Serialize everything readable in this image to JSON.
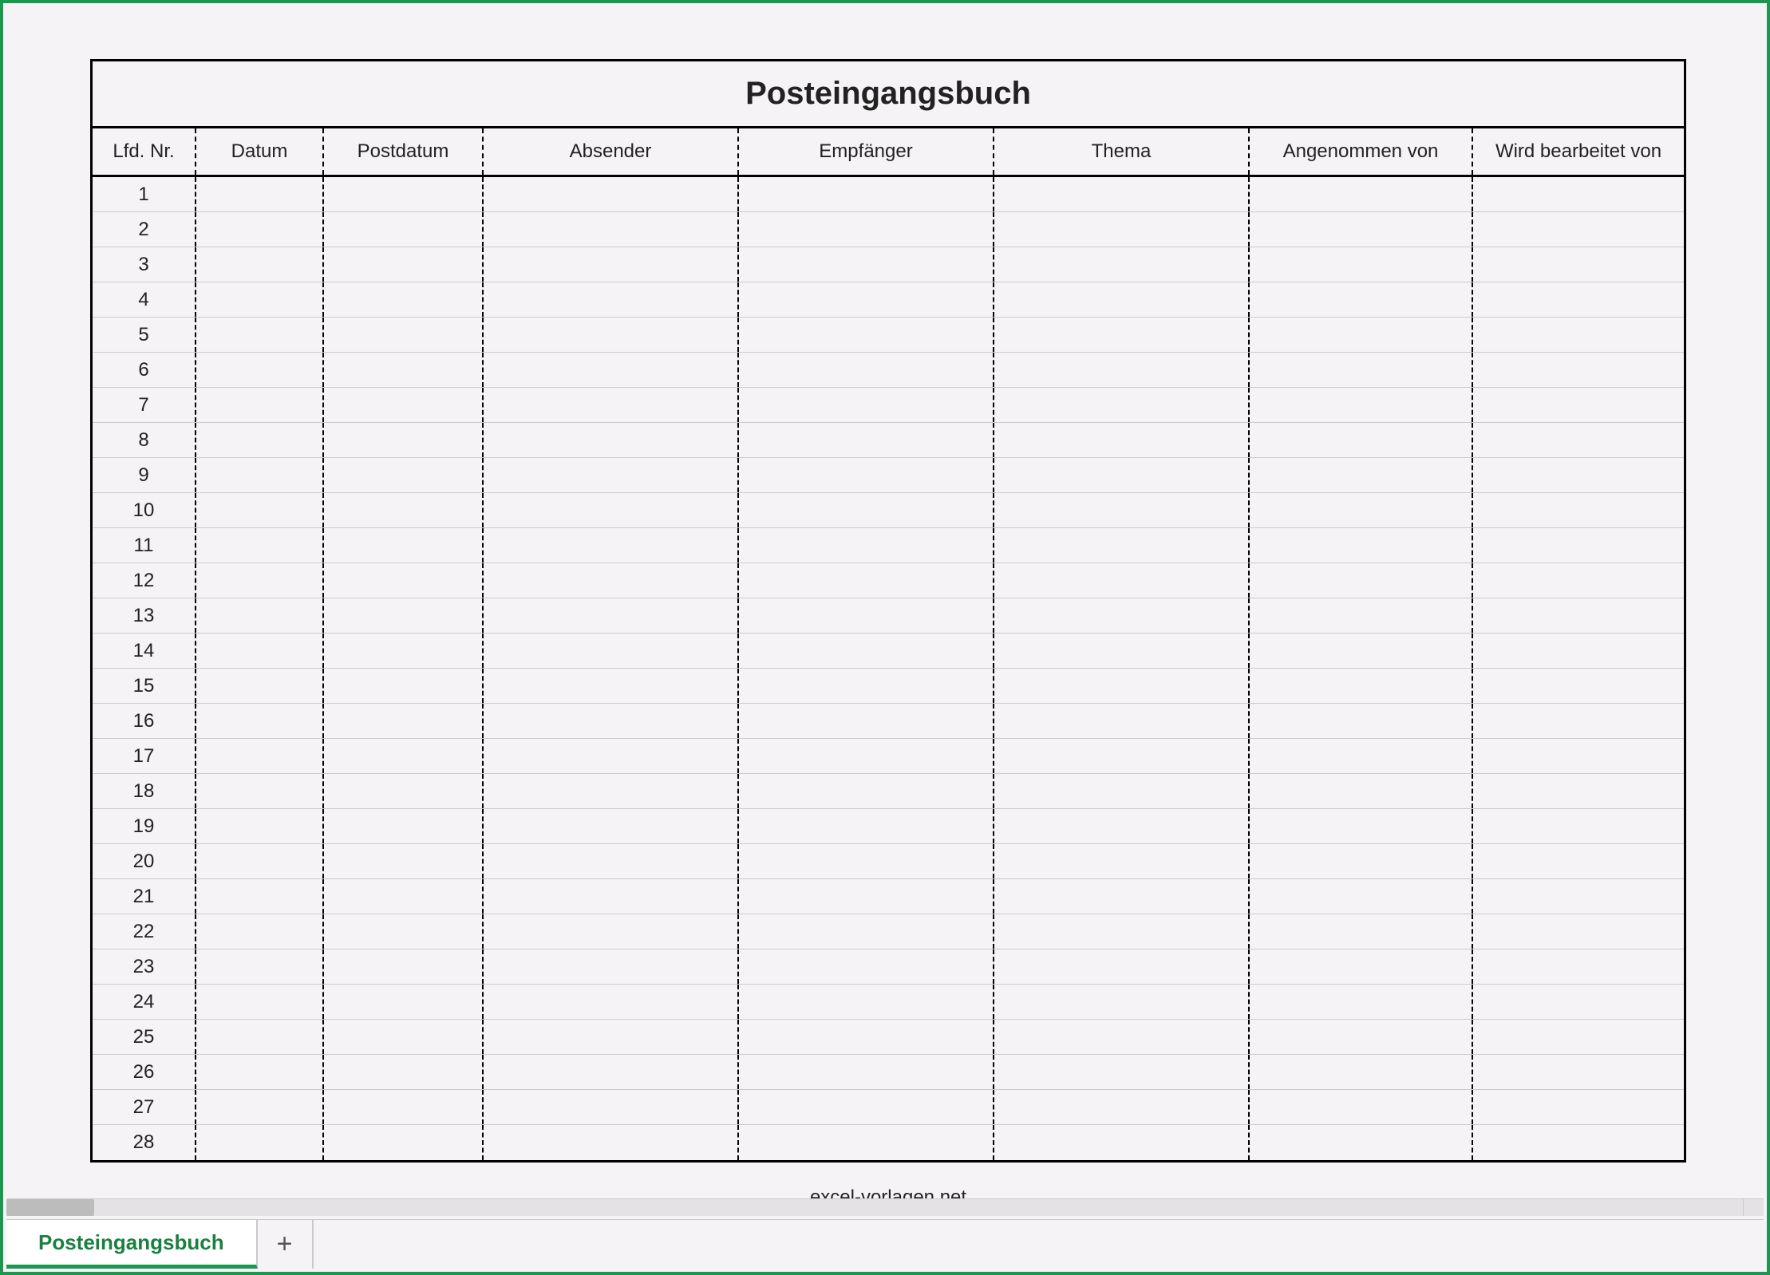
{
  "title": "Posteingangsbuch",
  "columns": [
    "Lfd. Nr.",
    "Datum",
    "Postdatum",
    "Absender",
    "Empfänger",
    "Thema",
    "Angenommen von",
    "Wird bearbeitet von"
  ],
  "rows": [
    {
      "nr": "1"
    },
    {
      "nr": "2"
    },
    {
      "nr": "3"
    },
    {
      "nr": "4"
    },
    {
      "nr": "5"
    },
    {
      "nr": "6"
    },
    {
      "nr": "7"
    },
    {
      "nr": "8"
    },
    {
      "nr": "9"
    },
    {
      "nr": "10"
    },
    {
      "nr": "11"
    },
    {
      "nr": "12"
    },
    {
      "nr": "13"
    },
    {
      "nr": "14"
    },
    {
      "nr": "15"
    },
    {
      "nr": "16"
    },
    {
      "nr": "17"
    },
    {
      "nr": "18"
    },
    {
      "nr": "19"
    },
    {
      "nr": "20"
    },
    {
      "nr": "21"
    },
    {
      "nr": "22"
    },
    {
      "nr": "23"
    },
    {
      "nr": "24"
    },
    {
      "nr": "25"
    },
    {
      "nr": "26"
    },
    {
      "nr": "27"
    },
    {
      "nr": "28"
    }
  ],
  "footer": "excel-vorlagen.net",
  "sheet_tab": "Posteingangsbuch",
  "add_sheet_glyph": "+"
}
